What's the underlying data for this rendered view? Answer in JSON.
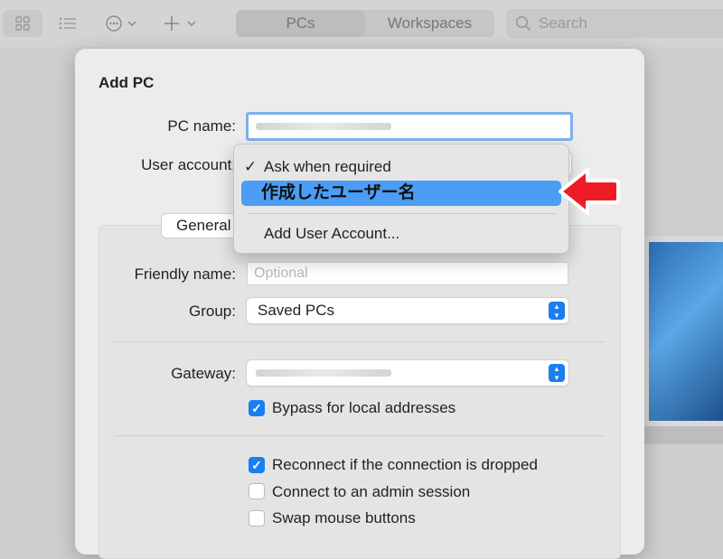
{
  "toolbar": {
    "icons": [
      "grid-view-icon",
      "list-view-icon",
      "more-icon",
      "add-icon"
    ],
    "tabs": [
      {
        "label": "PCs",
        "active": true
      },
      {
        "label": "Workspaces",
        "active": false
      }
    ],
    "search_placeholder": "Search"
  },
  "dialog": {
    "title": "Add PC",
    "pc_name_label": "PC name:",
    "user_account_label": "User account:",
    "tab_general": "General",
    "friendly_name_label": "Friendly name:",
    "friendly_name_placeholder": "Optional",
    "group_label": "Group:",
    "group_value": "Saved PCs",
    "gateway_label": "Gateway:",
    "options": [
      {
        "label": "Bypass for local addresses",
        "checked": true
      },
      {
        "label": "Reconnect if the connection is dropped",
        "checked": true
      },
      {
        "label": "Connect to an admin session",
        "checked": false
      },
      {
        "label": "Swap mouse buttons",
        "checked": false
      }
    ]
  },
  "menu": {
    "checkmark": "✓",
    "items": [
      "Ask when required",
      "作成したユーザー名",
      "Add User Account..."
    ],
    "checked_index": 0,
    "selected_index": 1
  },
  "colors": {
    "accent": "#1a7ef2",
    "highlight": "#4b9df5",
    "annotation_arrow": "#ee1c24"
  }
}
